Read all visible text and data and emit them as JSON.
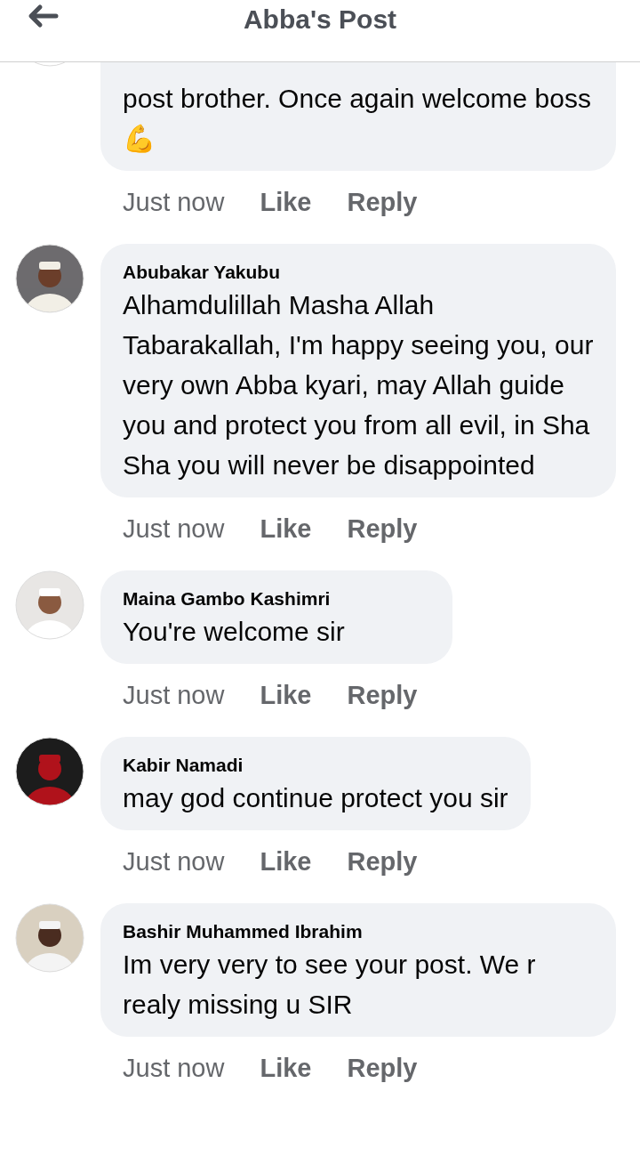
{
  "header": {
    "title": "Abba's Post"
  },
  "comments": [
    {
      "text": "post brother. Once again welcome boss 💪",
      "time": "Just now",
      "like": "Like",
      "reply": "Reply"
    },
    {
      "name": "Abubakar Yakubu",
      "text": "Alhamdulillah Masha Allah Tabarakallah, I'm happy seeing you, our very own Abba kyari, may Allah guide you and protect you from all evil, in Sha Sha you will never be disappointed",
      "time": "Just now",
      "like": "Like",
      "reply": "Reply"
    },
    {
      "name": "Maina Gambo Kashimri",
      "text": "You're welcome sir",
      "time": "Just now",
      "like": "Like",
      "reply": "Reply"
    },
    {
      "name": "Kabir Namadi",
      "text": "may god continue protect you sir",
      "time": "Just now",
      "like": "Like",
      "reply": "Reply"
    },
    {
      "name": "Bashir Muhammed Ibrahim",
      "text": "Im very very to see your post. We r realy missing u SIR",
      "time": "Just now",
      "like": "Like",
      "reply": "Reply"
    }
  ]
}
